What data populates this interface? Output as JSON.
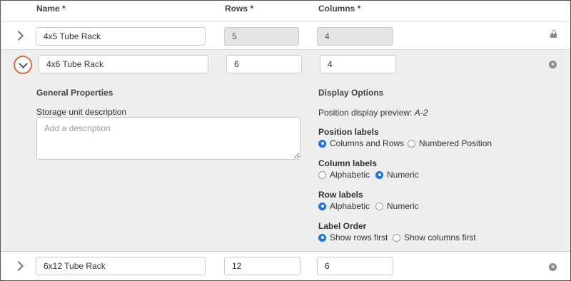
{
  "columns": {
    "name": "Name *",
    "rows": "Rows *",
    "columns": "Columns *"
  },
  "rows": [
    {
      "name": "4x5 Tube Rack",
      "rows": "5",
      "columns": "4",
      "locked": true
    },
    {
      "name": "4x6 Tube Rack",
      "rows": "6",
      "columns": "4",
      "expanded": true
    },
    {
      "name": "6x12 Tube Rack",
      "rows": "12",
      "columns": "6"
    }
  ],
  "general": {
    "title": "General Properties",
    "description_label": "Storage unit description",
    "description_placeholder": "Add a description"
  },
  "display": {
    "title": "Display Options",
    "preview_label": "Position display preview:",
    "preview_value": "A-2",
    "position_labels": {
      "title": "Position labels",
      "options": [
        "Columns and Rows",
        "Numbered Position"
      ],
      "selected": "Columns and Rows"
    },
    "column_labels": {
      "title": "Column labels",
      "options": [
        "Alphabetic",
        "Numeric"
      ],
      "selected": "Numeric"
    },
    "row_labels": {
      "title": "Row labels",
      "options": [
        "Alphabetic",
        "Numeric"
      ],
      "selected": "Alphabetic"
    },
    "label_order": {
      "title": "Label Order",
      "options": [
        "Show rows first",
        "Show columns first"
      ],
      "selected": "Show rows first"
    }
  },
  "colors": {
    "accent": "#1a73e8",
    "expand_ring": "#e26a3b",
    "expanded_bg": "#eeeeee"
  }
}
